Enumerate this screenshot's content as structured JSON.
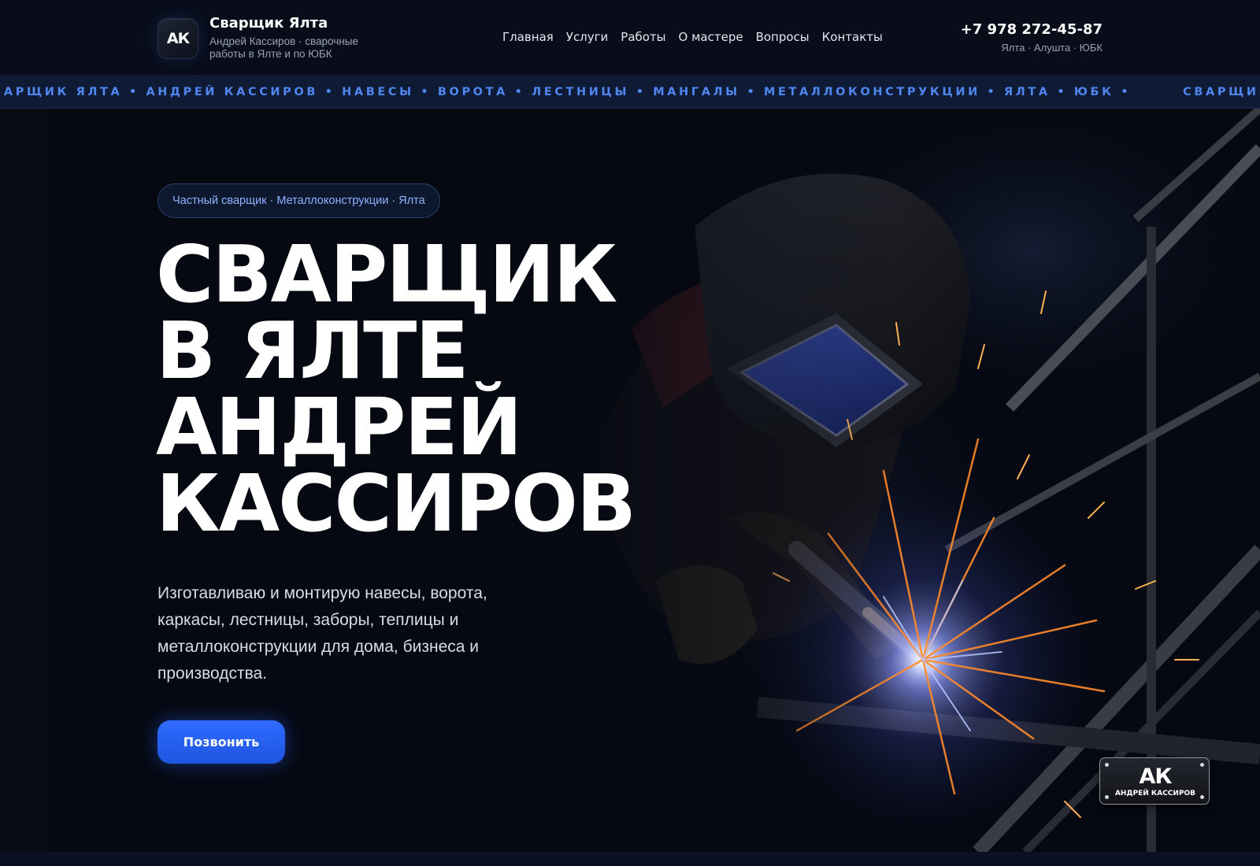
{
  "header": {
    "logo_mark": "АК",
    "brand_title": "Сварщик Ялта",
    "brand_subtitle": "Андрей Кассиров · сварочные работы в Ялте и по ЮБК",
    "nav": [
      {
        "label": "Главная"
      },
      {
        "label": "Услуги"
      },
      {
        "label": "Работы"
      },
      {
        "label": "О мастере"
      },
      {
        "label": "Вопросы"
      },
      {
        "label": "Контакты"
      }
    ],
    "phone": "+7 978 272-45-87",
    "regions": "Ялта · Алушта · ЮБК"
  },
  "ticker": {
    "text": "СВАРЩИК ЯЛТА • АНДРЕЙ КАССИРОВ • НАВЕСЫ • ВОРОТА • ЛЕСТНИЦЫ • МАНГАЛЫ • МЕТАЛЛОКОНСТРУКЦИИ • ЯЛТА • ЮБК •",
    "text_repeat": "СВАРЩИК ЯЛТА • АНДРЕЙ КАССИРОВ • НАВЕСЫ • ВОРОТА • ЛЕСТНИЦЫ • МАНГАЛЫ • МЕТАЛЛОКОНСТРУКЦИИ • ЯЛТА • ЮБК •"
  },
  "hero": {
    "pill": "Частный сварщик · Металлоконструкции · Ялта",
    "title_lines": [
      "Сварщик",
      "в Ялте",
      "Андрей",
      "Кассиров"
    ],
    "description": "Изготавливаю и монтирую навесы, ворота, каркасы, лестницы, заборы, теплицы и металлоконструкции для дома, бизнеса и производства.",
    "cta_label": "Позвонить",
    "background_image": "welder-with-sparks",
    "plate_mark": "АК",
    "plate_name": "АНДРЕЙ КАССИРОВ"
  },
  "colors": {
    "background": "#070b16",
    "accent": "#2f6bff",
    "ticker_text": "#4f86f0",
    "pill_text": "#8fb2ff"
  }
}
